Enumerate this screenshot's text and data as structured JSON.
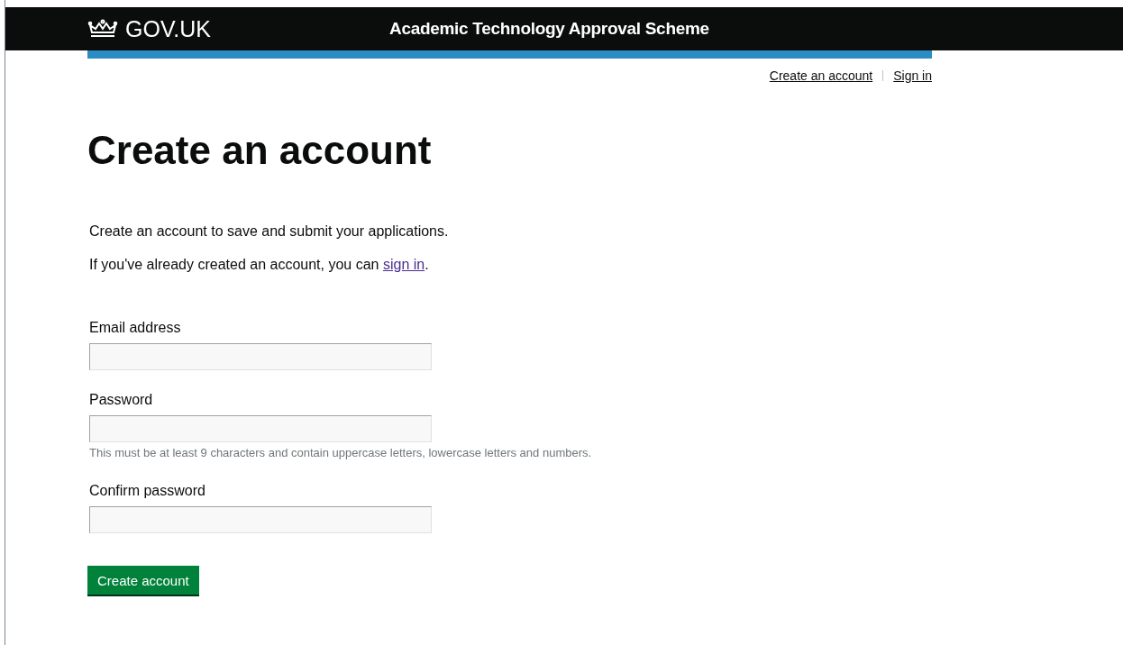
{
  "header": {
    "logo": "GOV.UK",
    "service_name": "Academic Technology Approval Scheme"
  },
  "account_links": [
    {
      "label": "Create an account"
    },
    {
      "label": "Sign in"
    }
  ],
  "heading": "Create an account",
  "intro": "Create an account to save and submit your applications.",
  "sign_in_note": {
    "before": "If you've already created an account, you can ",
    "link": "sign in",
    "after": "."
  },
  "fields": [
    {
      "label": "Email address"
    },
    {
      "label": "Password",
      "hint": "This must be at least 9 characters and contain uppercase letters, lowercase letters and numbers."
    },
    {
      "label": "Confirm password"
    }
  ],
  "submit_button": "Create account"
}
